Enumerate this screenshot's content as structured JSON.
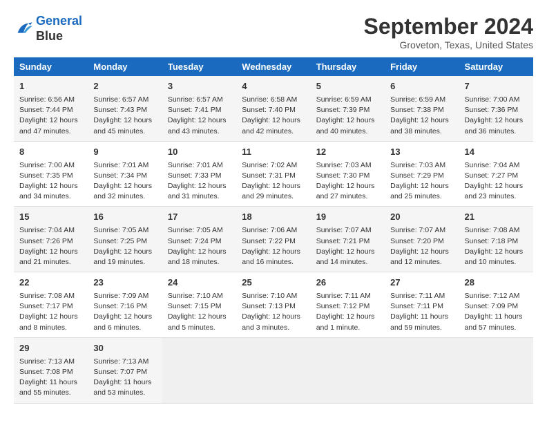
{
  "logo": {
    "line1": "General",
    "line2": "Blue"
  },
  "title": "September 2024",
  "subtitle": "Groveton, Texas, United States",
  "days_of_week": [
    "Sunday",
    "Monday",
    "Tuesday",
    "Wednesday",
    "Thursday",
    "Friday",
    "Saturday"
  ],
  "weeks": [
    [
      {
        "day": "1",
        "sunrise": "Sunrise: 6:56 AM",
        "sunset": "Sunset: 7:44 PM",
        "daylight": "Daylight: 12 hours and 47 minutes."
      },
      {
        "day": "2",
        "sunrise": "Sunrise: 6:57 AM",
        "sunset": "Sunset: 7:43 PM",
        "daylight": "Daylight: 12 hours and 45 minutes."
      },
      {
        "day": "3",
        "sunrise": "Sunrise: 6:57 AM",
        "sunset": "Sunset: 7:41 PM",
        "daylight": "Daylight: 12 hours and 43 minutes."
      },
      {
        "day": "4",
        "sunrise": "Sunrise: 6:58 AM",
        "sunset": "Sunset: 7:40 PM",
        "daylight": "Daylight: 12 hours and 42 minutes."
      },
      {
        "day": "5",
        "sunrise": "Sunrise: 6:59 AM",
        "sunset": "Sunset: 7:39 PM",
        "daylight": "Daylight: 12 hours and 40 minutes."
      },
      {
        "day": "6",
        "sunrise": "Sunrise: 6:59 AM",
        "sunset": "Sunset: 7:38 PM",
        "daylight": "Daylight: 12 hours and 38 minutes."
      },
      {
        "day": "7",
        "sunrise": "Sunrise: 7:00 AM",
        "sunset": "Sunset: 7:36 PM",
        "daylight": "Daylight: 12 hours and 36 minutes."
      }
    ],
    [
      {
        "day": "8",
        "sunrise": "Sunrise: 7:00 AM",
        "sunset": "Sunset: 7:35 PM",
        "daylight": "Daylight: 12 hours and 34 minutes."
      },
      {
        "day": "9",
        "sunrise": "Sunrise: 7:01 AM",
        "sunset": "Sunset: 7:34 PM",
        "daylight": "Daylight: 12 hours and 32 minutes."
      },
      {
        "day": "10",
        "sunrise": "Sunrise: 7:01 AM",
        "sunset": "Sunset: 7:33 PM",
        "daylight": "Daylight: 12 hours and 31 minutes."
      },
      {
        "day": "11",
        "sunrise": "Sunrise: 7:02 AM",
        "sunset": "Sunset: 7:31 PM",
        "daylight": "Daylight: 12 hours and 29 minutes."
      },
      {
        "day": "12",
        "sunrise": "Sunrise: 7:03 AM",
        "sunset": "Sunset: 7:30 PM",
        "daylight": "Daylight: 12 hours and 27 minutes."
      },
      {
        "day": "13",
        "sunrise": "Sunrise: 7:03 AM",
        "sunset": "Sunset: 7:29 PM",
        "daylight": "Daylight: 12 hours and 25 minutes."
      },
      {
        "day": "14",
        "sunrise": "Sunrise: 7:04 AM",
        "sunset": "Sunset: 7:27 PM",
        "daylight": "Daylight: 12 hours and 23 minutes."
      }
    ],
    [
      {
        "day": "15",
        "sunrise": "Sunrise: 7:04 AM",
        "sunset": "Sunset: 7:26 PM",
        "daylight": "Daylight: 12 hours and 21 minutes."
      },
      {
        "day": "16",
        "sunrise": "Sunrise: 7:05 AM",
        "sunset": "Sunset: 7:25 PM",
        "daylight": "Daylight: 12 hours and 19 minutes."
      },
      {
        "day": "17",
        "sunrise": "Sunrise: 7:05 AM",
        "sunset": "Sunset: 7:24 PM",
        "daylight": "Daylight: 12 hours and 18 minutes."
      },
      {
        "day": "18",
        "sunrise": "Sunrise: 7:06 AM",
        "sunset": "Sunset: 7:22 PM",
        "daylight": "Daylight: 12 hours and 16 minutes."
      },
      {
        "day": "19",
        "sunrise": "Sunrise: 7:07 AM",
        "sunset": "Sunset: 7:21 PM",
        "daylight": "Daylight: 12 hours and 14 minutes."
      },
      {
        "day": "20",
        "sunrise": "Sunrise: 7:07 AM",
        "sunset": "Sunset: 7:20 PM",
        "daylight": "Daylight: 12 hours and 12 minutes."
      },
      {
        "day": "21",
        "sunrise": "Sunrise: 7:08 AM",
        "sunset": "Sunset: 7:18 PM",
        "daylight": "Daylight: 12 hours and 10 minutes."
      }
    ],
    [
      {
        "day": "22",
        "sunrise": "Sunrise: 7:08 AM",
        "sunset": "Sunset: 7:17 PM",
        "daylight": "Daylight: 12 hours and 8 minutes."
      },
      {
        "day": "23",
        "sunrise": "Sunrise: 7:09 AM",
        "sunset": "Sunset: 7:16 PM",
        "daylight": "Daylight: 12 hours and 6 minutes."
      },
      {
        "day": "24",
        "sunrise": "Sunrise: 7:10 AM",
        "sunset": "Sunset: 7:15 PM",
        "daylight": "Daylight: 12 hours and 5 minutes."
      },
      {
        "day": "25",
        "sunrise": "Sunrise: 7:10 AM",
        "sunset": "Sunset: 7:13 PM",
        "daylight": "Daylight: 12 hours and 3 minutes."
      },
      {
        "day": "26",
        "sunrise": "Sunrise: 7:11 AM",
        "sunset": "Sunset: 7:12 PM",
        "daylight": "Daylight: 12 hours and 1 minute."
      },
      {
        "day": "27",
        "sunrise": "Sunrise: 7:11 AM",
        "sunset": "Sunset: 7:11 PM",
        "daylight": "Daylight: 11 hours and 59 minutes."
      },
      {
        "day": "28",
        "sunrise": "Sunrise: 7:12 AM",
        "sunset": "Sunset: 7:09 PM",
        "daylight": "Daylight: 11 hours and 57 minutes."
      }
    ],
    [
      {
        "day": "29",
        "sunrise": "Sunrise: 7:13 AM",
        "sunset": "Sunset: 7:08 PM",
        "daylight": "Daylight: 11 hours and 55 minutes."
      },
      {
        "day": "30",
        "sunrise": "Sunrise: 7:13 AM",
        "sunset": "Sunset: 7:07 PM",
        "daylight": "Daylight: 11 hours and 53 minutes."
      },
      null,
      null,
      null,
      null,
      null
    ]
  ]
}
